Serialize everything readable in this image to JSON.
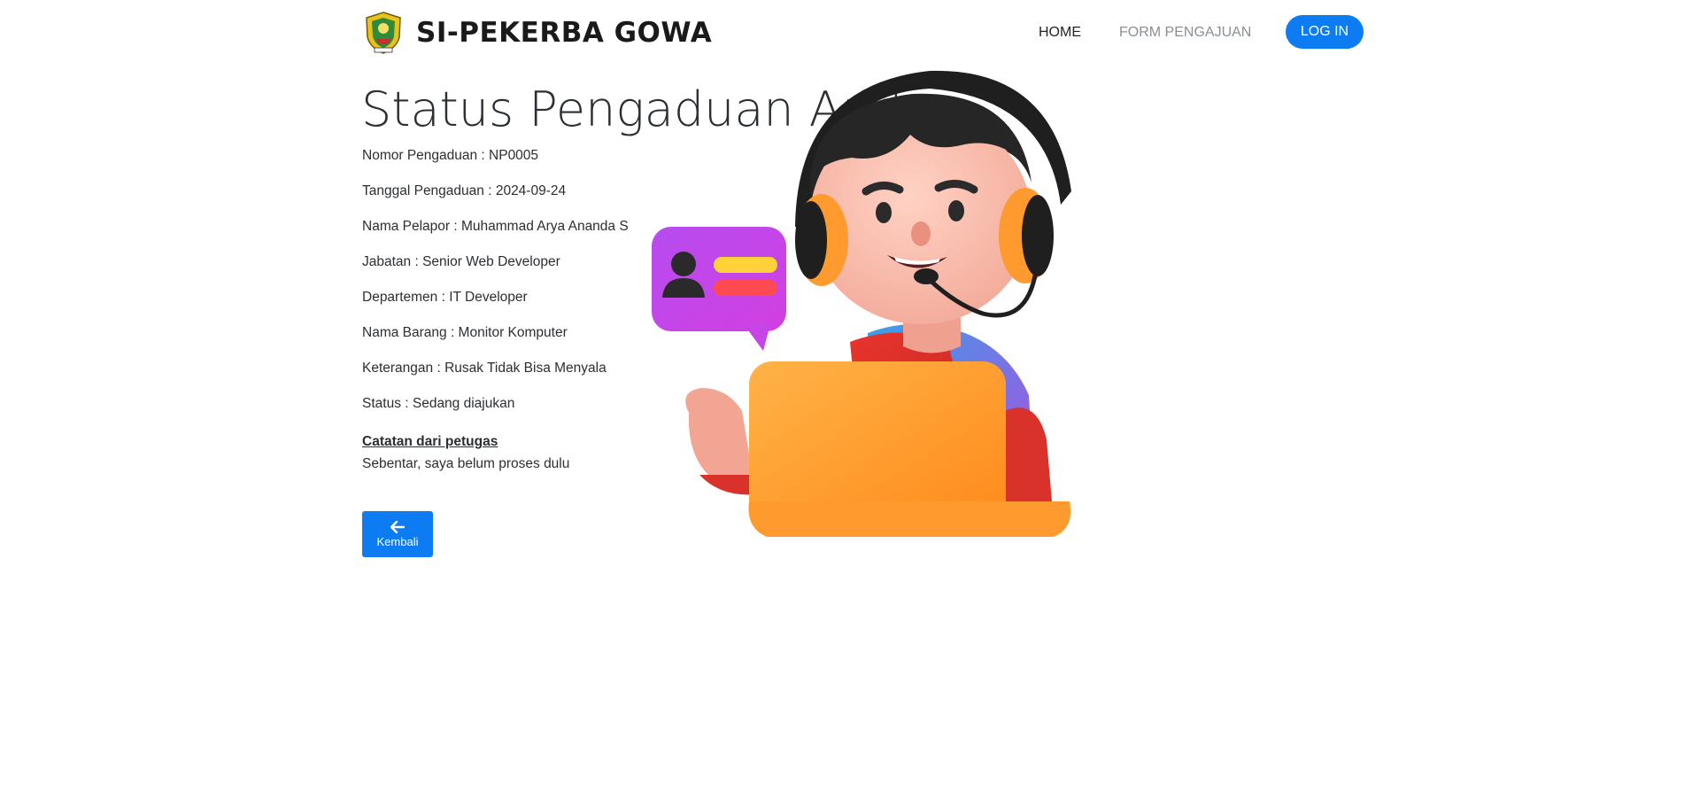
{
  "brand": {
    "name": "SI-PEKERBA GOWA",
    "logo_icon": "gowa-emblem-icon"
  },
  "nav": {
    "home_label": "HOME",
    "form_label": "FORM PENGAJUAN",
    "login_label": "LOG IN"
  },
  "page": {
    "title": "Status Pengaduan Anda",
    "fields": [
      {
        "label": "Nomor Pengaduan",
        "value": "NP0005",
        "text": "Nomor Pengaduan : NP0005"
      },
      {
        "label": "Tanggal Pengaduan",
        "value": "2024-09-24",
        "text": "Tanggal Pengaduan : 2024-09-24"
      },
      {
        "label": "Nama Pelapor",
        "value": "Muhammad Arya Ananda S",
        "text": "Nama Pelapor : Muhammad Arya Ananda S"
      },
      {
        "label": "Jabatan",
        "value": "Senior Web Developer",
        "text": "Jabatan : Senior Web Developer"
      },
      {
        "label": "Departemen",
        "value": "IT Developer",
        "text": "Departemen : IT Developer"
      },
      {
        "label": "Nama Barang",
        "value": "Monitor Komputer",
        "text": "Nama Barang : Monitor Komputer"
      },
      {
        "label": "Keterangan",
        "value": "Rusak Tidak Bisa Menyala",
        "text": "Keterangan : Rusak Tidak Bisa Menyala"
      },
      {
        "label": "Status",
        "value": "Sedang diajukan",
        "text": "Status : Sedang diajukan"
      }
    ],
    "note_heading": "Catatan dari petugas",
    "note_body": "Sebentar, saya belum proses dulu",
    "back_label": "Kembali",
    "back_icon": "arrow-left-icon",
    "illustration_icon": "customer-support-illustration"
  },
  "colors": {
    "primary": "#0d7cf2",
    "text": "#2b2f33",
    "nav_muted": "#8a8f94"
  }
}
